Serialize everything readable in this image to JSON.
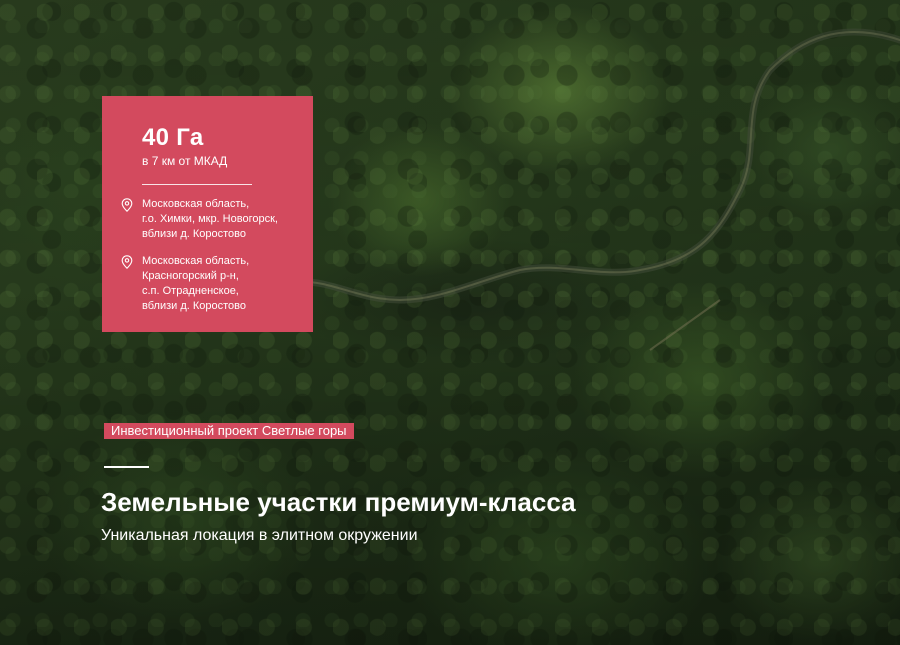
{
  "card": {
    "area": "40 Га",
    "distance": "в 7 км от МКАД",
    "locations": [
      {
        "line1": "Московская область,",
        "line2": "г.о. Химки, мкр. Новогорск,",
        "line3": "вблизи д. Коростово"
      },
      {
        "line1": "Московская область,",
        "line2": "Красногорский р-н,",
        "line3": "с.п. Отрадненское,",
        "line4": "вблизи д. Коростово"
      }
    ],
    "icon": "location-pin-icon",
    "color": "#d34a5e"
  },
  "hero": {
    "badge": "Инвестиционный проект Светлые горы",
    "title": "Земельные участки премиум-класса",
    "subtitle": "Уникальная локация в элитном окружении",
    "background": "aerial-forest-photo"
  }
}
